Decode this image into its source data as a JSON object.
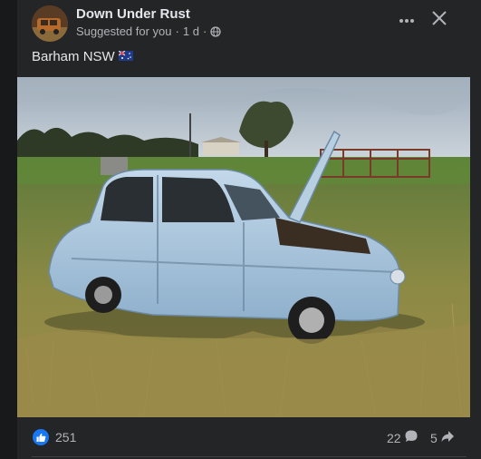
{
  "post": {
    "page_name": "Down Under Rust",
    "suggested": "Suggested for you",
    "separator": "·",
    "time": "1 d",
    "dot": "·",
    "caption": "Barham NSW",
    "flag_icon": "australia-flag-icon",
    "privacy_icon": "globe-icon"
  },
  "header": {
    "more_icon": "more-options-icon",
    "close_icon": "close-icon"
  },
  "photo": {
    "subject": "car",
    "car_color": "#a8c4da",
    "sky_color": "#b9c6d6",
    "grass_color": "#7a8a3f"
  },
  "footer": {
    "like_count": "251",
    "comment_count": "22",
    "share_count": "5",
    "like_icon": "like-thumb-icon",
    "comment_icon": "comment-bubble-icon",
    "share_icon": "share-arrow-icon",
    "accent": "#1877f2"
  }
}
